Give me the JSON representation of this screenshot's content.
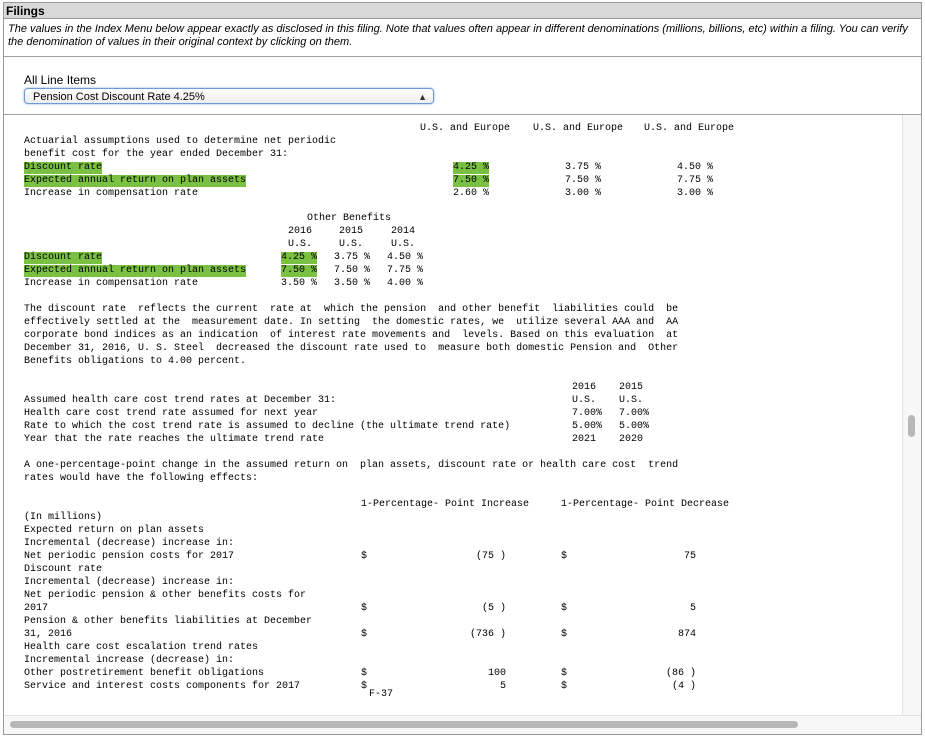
{
  "header": {
    "title": "Filings",
    "note": "The values in the Index Menu below appear exactly as disclosed in this filing. Note that values often appear in different denominations (millions, billions, etc) within a filing. You can verify the denomination of values in their original context by clicking on them."
  },
  "line_items": {
    "label": "All Line Items",
    "selected": "Pension Cost Discount Rate 4.25%"
  },
  "table1": {
    "col_headers": [
      "U.S. and Europe",
      "U.S. and Europe",
      "U.S. and Europe"
    ],
    "intro_line1": "Actuarial assumptions used to determine net periodic",
    "intro_line2": "benefit cost for the year ended December 31:",
    "rows": [
      {
        "label": "Discount rate",
        "v1": "4.25 %",
        "v2": "3.75 %",
        "v3": "4.50 %"
      },
      {
        "label": "Expected annual return on plan assets",
        "v1": "7.50 %",
        "v2": "7.50 %",
        "v3": "7.75 %"
      },
      {
        "label": "Increase in compensation rate",
        "v1": "2.60 %",
        "v2": "3.00 %",
        "v3": "3.00 %"
      }
    ]
  },
  "table2": {
    "group_header": "Other Benefits",
    "years": [
      "2016",
      "2015",
      "2014"
    ],
    "regions": [
      "U.S.",
      "U.S.",
      "U.S."
    ],
    "rows": [
      {
        "label": "Discount rate",
        "v1": "4.25 %",
        "v2": "3.75 %",
        "v3": "4.50 %"
      },
      {
        "label": "Expected annual return on plan assets",
        "v1": "7.50 %",
        "v2": "7.50 %",
        "v3": "7.75 %"
      },
      {
        "label": "Increase in compensation rate",
        "v1": "3.50 %",
        "v2": "3.50 %",
        "v3": "4.00 %"
      }
    ]
  },
  "paragraph": [
    "The discount rate  reflects the current  rate at  which the pension  and other benefit  liabilities could  be",
    "effectively settled at the  measurement date. In setting  the domestic rates, we  utilize several AAA and  AA",
    "corporate bond indices as an indication  of interest rate movements and  levels. Based on this evaluation  at",
    "December 31, 2016, U. S. Steel  decreased the discount rate used to  measure both domestic Pension and  Other",
    "Benefits obligations to 4.00 percent."
  ],
  "table3": {
    "years": [
      "2016",
      "2015"
    ],
    "regions": [
      "U.S.",
      "U.S."
    ],
    "rows": [
      {
        "label": "Assumed health care cost trend rates at December 31:",
        "v1": "",
        "v2": ""
      },
      {
        "label": "Health care cost trend rate assumed for next year",
        "v1": "7.00%",
        "v2": "7.00%"
      },
      {
        "label": "Rate to which the cost trend rate is assumed to decline (the ultimate trend rate)",
        "v1": "5.00%",
        "v2": "5.00%"
      },
      {
        "label": "Year that the rate reaches the ultimate trend rate",
        "v1": "2021",
        "v2": "2020"
      }
    ]
  },
  "sensitivity_intro": [
    "A one-percentage-point change in the assumed return on  plan assets, discount rate or health care cost  trend",
    "rates would have the following effects:"
  ],
  "table4": {
    "h1": "1-Percentage- Point Increase",
    "h2": "1-Percentage- Point Decrease",
    "rows": [
      {
        "label": "(In millions)",
        "c1": "",
        "v1": "",
        "c2": "",
        "v2": ""
      },
      {
        "label": "Expected return on plan assets",
        "c1": "",
        "v1": "",
        "c2": "",
        "v2": ""
      },
      {
        "label": "Incremental (decrease) increase in:",
        "c1": "",
        "v1": "",
        "c2": "",
        "v2": ""
      },
      {
        "label": "Net periodic pension costs for 2017",
        "c1": "$",
        "v1": "(75 )",
        "c2": "$",
        "v2": "75"
      },
      {
        "label": "Discount rate",
        "c1": "",
        "v1": "",
        "c2": "",
        "v2": ""
      },
      {
        "label": "Incremental (decrease) increase in:",
        "c1": "",
        "v1": "",
        "c2": "",
        "v2": ""
      },
      {
        "label": "Net periodic pension & other benefits costs for",
        "c1": "",
        "v1": "",
        "c2": "",
        "v2": ""
      },
      {
        "label": "2017",
        "c1": "$",
        "v1": "(5 )",
        "c2": "$",
        "v2": "5"
      },
      {
        "label": "Pension & other benefits liabilities at December",
        "c1": "",
        "v1": "",
        "c2": "",
        "v2": ""
      },
      {
        "label": "31, 2016",
        "c1": "$",
        "v1": "(736 )",
        "c2": "$",
        "v2": "874"
      },
      {
        "label": "Health care cost escalation trend rates",
        "c1": "",
        "v1": "",
        "c2": "",
        "v2": ""
      },
      {
        "label": "Incremental increase (decrease) in:",
        "c1": "",
        "v1": "",
        "c2": "",
        "v2": ""
      },
      {
        "label": "Other postretirement benefit obligations",
        "c1": "$",
        "v1": "100",
        "c2": "$",
        "v2": "(86 )"
      },
      {
        "label": "Service and interest costs components for 2017",
        "c1": "$",
        "v1": "5",
        "c2": "$",
        "v2": "(4 )"
      }
    ]
  },
  "page_number": "F-37"
}
